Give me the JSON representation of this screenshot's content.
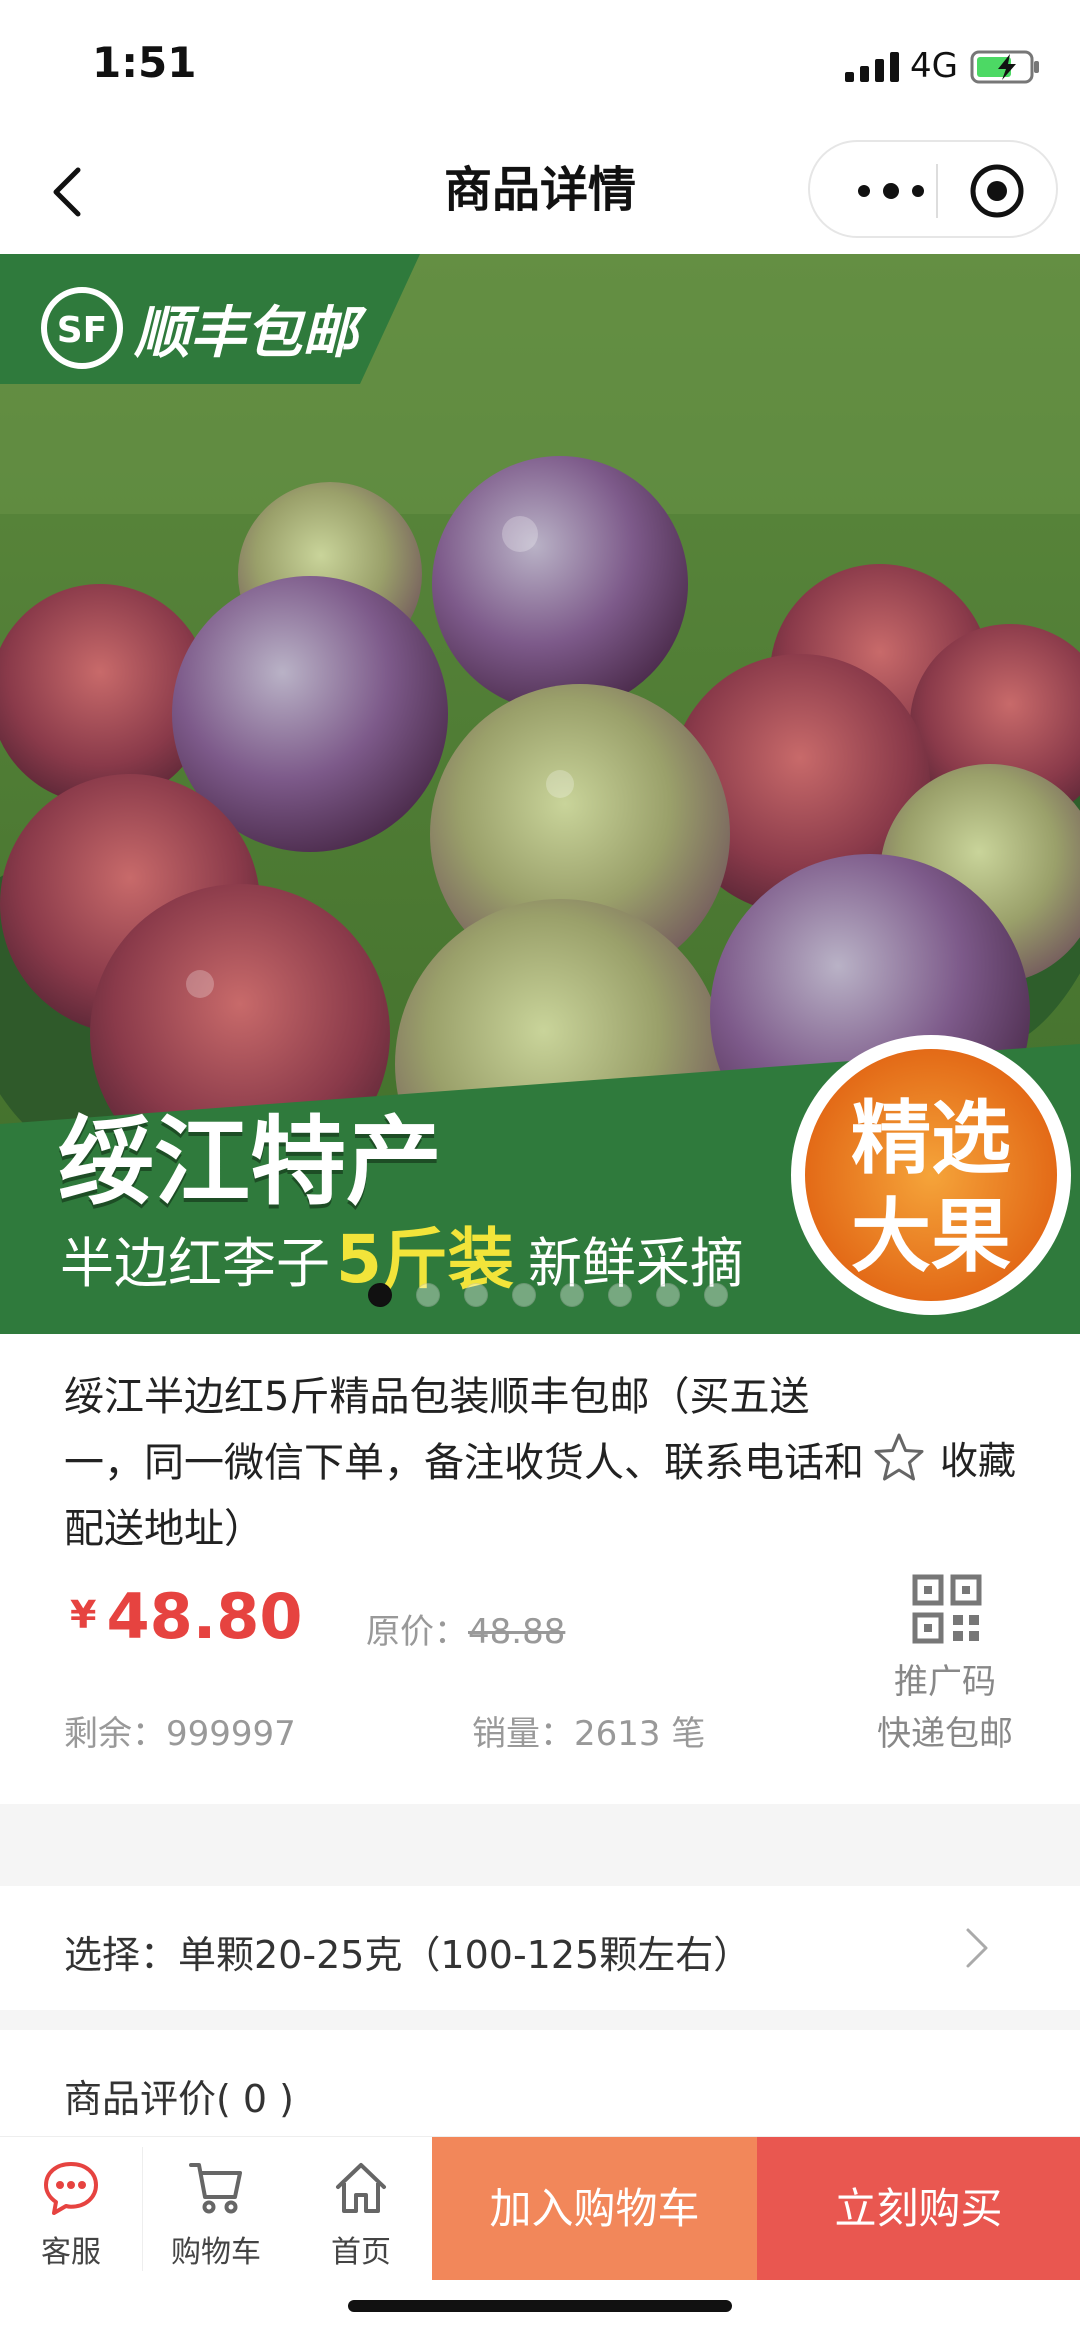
{
  "status_bar": {
    "time": "1:51",
    "network": "4G"
  },
  "nav": {
    "title": "商品详情"
  },
  "banner": {
    "badge": "顺丰包邮",
    "headline": "绥江特产",
    "subline_a": "半边红李子",
    "subline_b": "5斤装",
    "subline_c": "新鲜采摘",
    "sticker_line1": "精选",
    "sticker_line2": "大果",
    "slide_count": 8,
    "active_slide": 1
  },
  "product": {
    "title": "绥江半边红5斤精品包装顺丰包邮（买五送一，同一微信下单，备注收货人、联系电话和配送地址）",
    "favorite_label": "收藏",
    "price_symbol": "¥",
    "price": "48.80",
    "original_price_label": "原价：",
    "original_price": "48.88",
    "promo_code_label": "推广码",
    "remaining": "剩余：999997",
    "sales": "销量：2613 笔",
    "shipping": "快递包邮"
  },
  "options": {
    "select_label": "选择：单颗20-25克（100-125颗左右）"
  },
  "reviews": {
    "label": "商品评价( 0 )"
  },
  "bottom_bar": {
    "service_label": "客服",
    "cart_label": "购物车",
    "home_label": "首页",
    "add_to_cart_label": "加入购物车",
    "buy_now_label": "立刻购买"
  },
  "colors": {
    "price_red": "#e64340",
    "cart_orange": "#f2875a",
    "buy_red": "#e95750",
    "banner_green": "#2f7a3c"
  }
}
